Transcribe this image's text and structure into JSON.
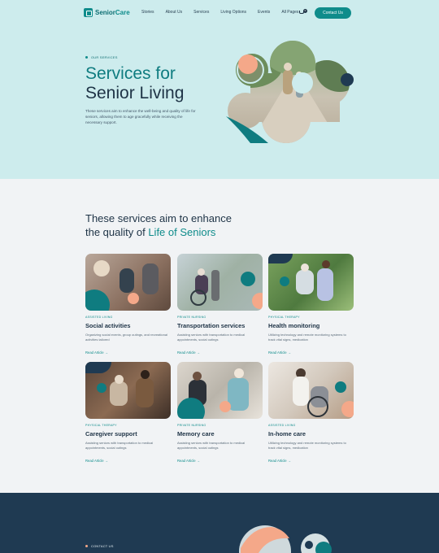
{
  "brand": {
    "name_part1": "Senior",
    "name_part2": "Care"
  },
  "nav": {
    "items": [
      "Stories",
      "About Us",
      "Services",
      "Living Options",
      "Events",
      "All Pages"
    ]
  },
  "cart": {
    "count": "0"
  },
  "header": {
    "contact_label": "Contact Us"
  },
  "hero": {
    "eyebrow": "OUR SERVICES",
    "title_line1": "Services for",
    "title_line2": "Senior Living",
    "description": "These services aim to enhance the well-being and quality of life for seniors, allowing them to age gracefully while receiving the necessary support."
  },
  "services": {
    "title_line1": "These services aim to enhance",
    "title_line2_prefix": "the quality of ",
    "title_line2_accent": "Life of Seniors",
    "cards": [
      {
        "tag": "ASSISTED LIVING",
        "title": "Social activities",
        "desc": "Organizing social events, group outings, and recreational activities tailored",
        "more": "Read Article →"
      },
      {
        "tag": "PRIVATE NURSING",
        "title": "Transportation services",
        "desc": "Assisting seniors with transportation to medical appointments, social outings",
        "more": "Read Article →"
      },
      {
        "tag": "PHYSICAL THERAPY",
        "title": "Health monitoring",
        "desc": "Utilizing technology and remote monitoring systems to track vital signs, medication",
        "more": "Read Article →"
      },
      {
        "tag": "PHYSICAL THERAPY",
        "title": "Caregiver support",
        "desc": "Assisting seniors with transportation to medical appointments, social outings",
        "more": "Read Article →"
      },
      {
        "tag": "PRIVATE NURSING",
        "title": "Memory care",
        "desc": "Assisting seniors with transportation to medical appointments, social outings",
        "more": "Read Article →"
      },
      {
        "tag": "ASSISTED LIVING",
        "title": "In-home care",
        "desc": "Utilizing technology and remote monitoring systems to track vital signs, medication",
        "more": "Read Article →"
      }
    ]
  },
  "contact_section": {
    "eyebrow": "CONTACT US"
  },
  "colors": {
    "teal": "#0f8c8b",
    "peach": "#f4a889",
    "navy": "#1f3a52",
    "hero_bg": "#cdeced"
  }
}
